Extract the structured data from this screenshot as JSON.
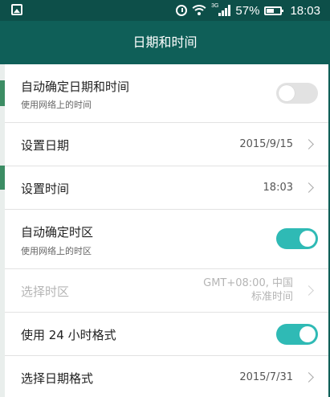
{
  "status_bar": {
    "network_type": "3G",
    "battery_percent": "57%",
    "battery_level": 0.57,
    "time": "18:03"
  },
  "header": {
    "title": "日期和时间"
  },
  "settings": {
    "auto_datetime": {
      "title": "自动确定日期和时间",
      "subtitle": "使用网络上的时间",
      "enabled": false
    },
    "set_date": {
      "title": "设置日期",
      "value": "2015/9/15"
    },
    "set_time": {
      "title": "设置时间",
      "value": "18:03"
    },
    "auto_timezone": {
      "title": "自动确定时区",
      "subtitle": "使用网络上的时区",
      "enabled": true
    },
    "select_timezone": {
      "title": "选择时区",
      "value_line1": "GMT+08:00, 中国",
      "value_line2": "标准时间",
      "disabled": true
    },
    "use_24h": {
      "title": "使用 24 小时格式",
      "enabled": true
    },
    "date_format": {
      "title": "选择日期格式",
      "value": "2015/7/31"
    }
  },
  "colors": {
    "header_bg": "#0f5f58",
    "status_bg": "#0d4f49",
    "switch_on": "#2fbab5",
    "switch_off": "#e2e2e2"
  }
}
